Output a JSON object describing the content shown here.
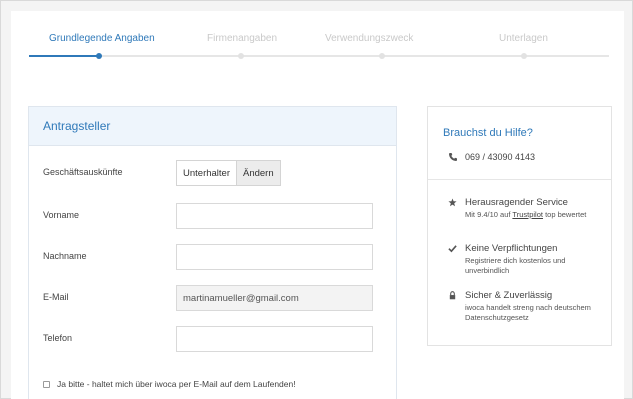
{
  "stepper": {
    "steps": [
      {
        "label": "Grundlegende Angaben",
        "active": true
      },
      {
        "label": "Firmenangaben",
        "active": false
      },
      {
        "label": "Verwendungszweck",
        "active": false
      },
      {
        "label": "Unterlagen",
        "active": false
      }
    ]
  },
  "form": {
    "title": "Antragsteller",
    "business_info": {
      "label": "Geschäftsauskünfte",
      "option_a": "Unterhalter",
      "option_b": "Ändern"
    },
    "first_name": {
      "label": "Vorname",
      "value": ""
    },
    "last_name": {
      "label": "Nachname",
      "value": ""
    },
    "email": {
      "label": "E-Mail",
      "value": "martinamueller@gmail.com"
    },
    "phone": {
      "label": "Telefon",
      "value": ""
    },
    "newsletter": {
      "label": "Ja bitte - haltet mich über iwoca per E-Mail auf dem Laufenden!",
      "checked": false
    }
  },
  "help": {
    "title": "Brauchst du Hilfe?",
    "phone": "069 / 43090 4143",
    "features": [
      {
        "icon": "star-icon",
        "title": "Herausragender Service",
        "desc_prefix": "Mit 9.4/10 auf ",
        "desc_link": "Trustpilot",
        "desc_suffix": " top bewertet"
      },
      {
        "icon": "check-icon",
        "title": "Keine Verpflichtungen",
        "desc": "Registriere dich kostenlos und unverbindlich"
      },
      {
        "icon": "lock-icon",
        "title": "Sicher & Zuverlässig",
        "desc": "iwoca handelt streng nach deutschem Datenschutzgesetz"
      }
    ]
  },
  "colors": {
    "accent": "#2f79b9",
    "header_bg": "#eef5fc"
  }
}
